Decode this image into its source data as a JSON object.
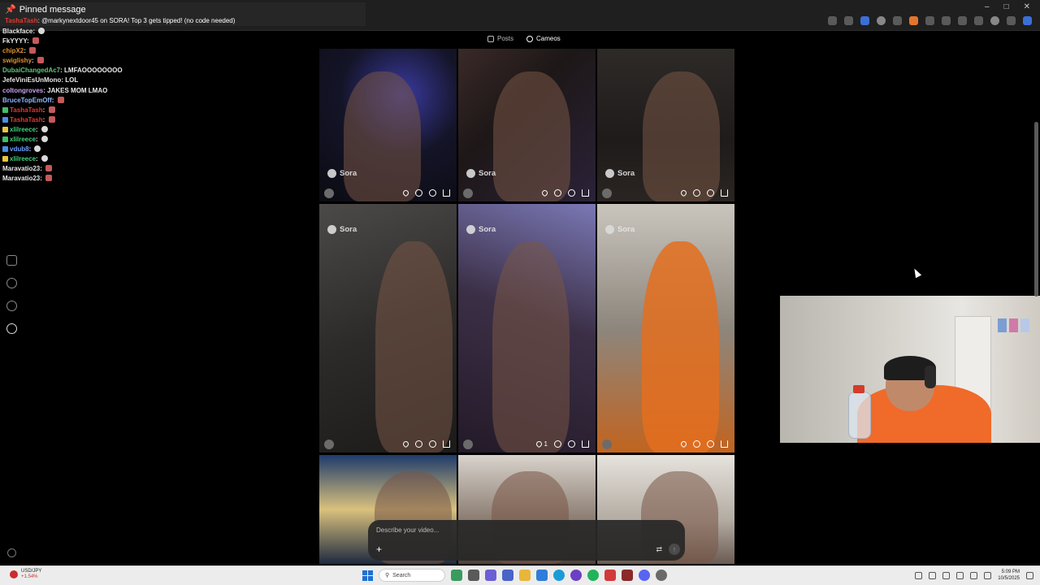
{
  "pinned": {
    "title": "Pinned message",
    "user": "TashaTash",
    "message": "@markynextdoor45 on SORA! Top 3 gets tipped! (no code needed)"
  },
  "chat": [
    {
      "user": "Blackface",
      "color": "#e6e6e6",
      "text": "",
      "emote": "white"
    },
    {
      "user": "FkYYYY",
      "color": "#e6e6e6",
      "text": "",
      "emote": "red"
    },
    {
      "user": "chipX2",
      "color": "#e0902e",
      "text": "",
      "emote": "red"
    },
    {
      "user": "swiglishy",
      "color": "#e0902e",
      "text": "",
      "emote": "red"
    },
    {
      "user": "DubaiChangedAc7",
      "color": "#5ec47a",
      "text": "LMFAOOOOOOOO",
      "emote": ""
    },
    {
      "user": "JefeViniEsUnMono",
      "color": "#e6e6e6",
      "text": "LOL",
      "emote": ""
    },
    {
      "user": "coltongroves",
      "color": "#c9a3f0",
      "text": "JAKES MOM LMAO",
      "emote": ""
    },
    {
      "user": "BruceTopEmOff",
      "color": "#8fb7ff",
      "text": "",
      "emote": "red"
    },
    {
      "user": "TashaTash",
      "color": "#e0392f",
      "text": "",
      "emote": "red"
    },
    {
      "user": "TashaTash",
      "color": "#e0392f",
      "text": "",
      "emote": "red"
    },
    {
      "user": "xlilreece",
      "color": "#3fd07a",
      "text": "",
      "emote": "white"
    },
    {
      "user": "xlilreece",
      "color": "#3fd07a",
      "text": "",
      "emote": "white"
    },
    {
      "user": "vdub8",
      "color": "#6aa0ff",
      "text": "",
      "emote": "white"
    },
    {
      "user": "xlilreece",
      "color": "#3fd07a",
      "text": "",
      "emote": "white"
    },
    {
      "user": "Maravatio23",
      "color": "#e6e6e6",
      "text": "",
      "emote": "red"
    },
    {
      "user": "Maravatio23",
      "color": "#e6e6e6",
      "text": "",
      "emote": "red"
    }
  ],
  "feed": {
    "tabs": [
      {
        "label": "Posts",
        "active": false
      },
      {
        "label": "Cameos",
        "active": true
      }
    ],
    "brand": "Sora",
    "cards": [
      {
        "scene": "scene-dark",
        "brand": true,
        "likes": ""
      },
      {
        "scene": "scene-party",
        "brand": true,
        "likes": ""
      },
      {
        "scene": "scene-room",
        "brand": true,
        "likes": ""
      },
      {
        "scene": "scene-car",
        "brand": true,
        "likes": ""
      },
      {
        "scene": "scene-blur",
        "brand": true,
        "likes": "1"
      },
      {
        "scene": "scene-jail",
        "brand": true,
        "likes": ""
      },
      {
        "scene": "scene-palace",
        "brand": false,
        "likes": ""
      },
      {
        "scene": "scene-wall1",
        "brand": false,
        "likes": ""
      },
      {
        "scene": "scene-wall2",
        "brand": false,
        "likes": ""
      }
    ]
  },
  "prompt": {
    "placeholder": "Describe your video...",
    "plus": "+",
    "settings": "⇄",
    "send": "↑"
  },
  "taskbar": {
    "ticker_symbol": "USD/JPY",
    "ticker_change": "+1.54%",
    "search": "Search",
    "time": "5:09 PM",
    "date": "10/5/2025"
  }
}
